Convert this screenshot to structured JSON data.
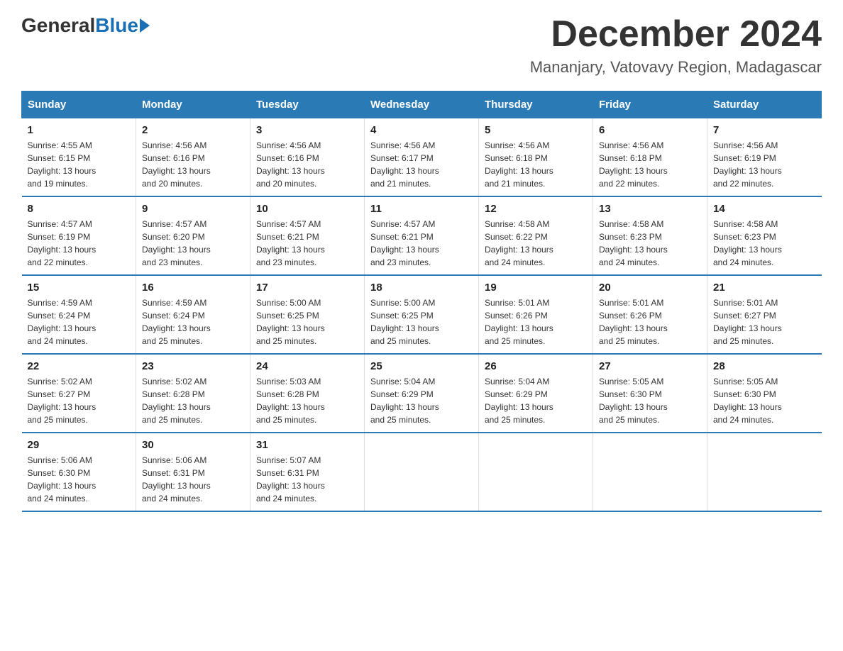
{
  "header": {
    "logo_general": "General",
    "logo_blue": "Blue",
    "month_title": "December 2024",
    "location": "Mananjary, Vatovavy Region, Madagascar"
  },
  "weekdays": [
    "Sunday",
    "Monday",
    "Tuesday",
    "Wednesday",
    "Thursday",
    "Friday",
    "Saturday"
  ],
  "weeks": [
    [
      {
        "day": "1",
        "sunrise": "4:55 AM",
        "sunset": "6:15 PM",
        "daylight": "13 hours and 19 minutes."
      },
      {
        "day": "2",
        "sunrise": "4:56 AM",
        "sunset": "6:16 PM",
        "daylight": "13 hours and 20 minutes."
      },
      {
        "day": "3",
        "sunrise": "4:56 AM",
        "sunset": "6:16 PM",
        "daylight": "13 hours and 20 minutes."
      },
      {
        "day": "4",
        "sunrise": "4:56 AM",
        "sunset": "6:17 PM",
        "daylight": "13 hours and 21 minutes."
      },
      {
        "day": "5",
        "sunrise": "4:56 AM",
        "sunset": "6:18 PM",
        "daylight": "13 hours and 21 minutes."
      },
      {
        "day": "6",
        "sunrise": "4:56 AM",
        "sunset": "6:18 PM",
        "daylight": "13 hours and 22 minutes."
      },
      {
        "day": "7",
        "sunrise": "4:56 AM",
        "sunset": "6:19 PM",
        "daylight": "13 hours and 22 minutes."
      }
    ],
    [
      {
        "day": "8",
        "sunrise": "4:57 AM",
        "sunset": "6:19 PM",
        "daylight": "13 hours and 22 minutes."
      },
      {
        "day": "9",
        "sunrise": "4:57 AM",
        "sunset": "6:20 PM",
        "daylight": "13 hours and 23 minutes."
      },
      {
        "day": "10",
        "sunrise": "4:57 AM",
        "sunset": "6:21 PM",
        "daylight": "13 hours and 23 minutes."
      },
      {
        "day": "11",
        "sunrise": "4:57 AM",
        "sunset": "6:21 PM",
        "daylight": "13 hours and 23 minutes."
      },
      {
        "day": "12",
        "sunrise": "4:58 AM",
        "sunset": "6:22 PM",
        "daylight": "13 hours and 24 minutes."
      },
      {
        "day": "13",
        "sunrise": "4:58 AM",
        "sunset": "6:23 PM",
        "daylight": "13 hours and 24 minutes."
      },
      {
        "day": "14",
        "sunrise": "4:58 AM",
        "sunset": "6:23 PM",
        "daylight": "13 hours and 24 minutes."
      }
    ],
    [
      {
        "day": "15",
        "sunrise": "4:59 AM",
        "sunset": "6:24 PM",
        "daylight": "13 hours and 24 minutes."
      },
      {
        "day": "16",
        "sunrise": "4:59 AM",
        "sunset": "6:24 PM",
        "daylight": "13 hours and 25 minutes."
      },
      {
        "day": "17",
        "sunrise": "5:00 AM",
        "sunset": "6:25 PM",
        "daylight": "13 hours and 25 minutes."
      },
      {
        "day": "18",
        "sunrise": "5:00 AM",
        "sunset": "6:25 PM",
        "daylight": "13 hours and 25 minutes."
      },
      {
        "day": "19",
        "sunrise": "5:01 AM",
        "sunset": "6:26 PM",
        "daylight": "13 hours and 25 minutes."
      },
      {
        "day": "20",
        "sunrise": "5:01 AM",
        "sunset": "6:26 PM",
        "daylight": "13 hours and 25 minutes."
      },
      {
        "day": "21",
        "sunrise": "5:01 AM",
        "sunset": "6:27 PM",
        "daylight": "13 hours and 25 minutes."
      }
    ],
    [
      {
        "day": "22",
        "sunrise": "5:02 AM",
        "sunset": "6:27 PM",
        "daylight": "13 hours and 25 minutes."
      },
      {
        "day": "23",
        "sunrise": "5:02 AM",
        "sunset": "6:28 PM",
        "daylight": "13 hours and 25 minutes."
      },
      {
        "day": "24",
        "sunrise": "5:03 AM",
        "sunset": "6:28 PM",
        "daylight": "13 hours and 25 minutes."
      },
      {
        "day": "25",
        "sunrise": "5:04 AM",
        "sunset": "6:29 PM",
        "daylight": "13 hours and 25 minutes."
      },
      {
        "day": "26",
        "sunrise": "5:04 AM",
        "sunset": "6:29 PM",
        "daylight": "13 hours and 25 minutes."
      },
      {
        "day": "27",
        "sunrise": "5:05 AM",
        "sunset": "6:30 PM",
        "daylight": "13 hours and 25 minutes."
      },
      {
        "day": "28",
        "sunrise": "5:05 AM",
        "sunset": "6:30 PM",
        "daylight": "13 hours and 24 minutes."
      }
    ],
    [
      {
        "day": "29",
        "sunrise": "5:06 AM",
        "sunset": "6:30 PM",
        "daylight": "13 hours and 24 minutes."
      },
      {
        "day": "30",
        "sunrise": "5:06 AM",
        "sunset": "6:31 PM",
        "daylight": "13 hours and 24 minutes."
      },
      {
        "day": "31",
        "sunrise": "5:07 AM",
        "sunset": "6:31 PM",
        "daylight": "13 hours and 24 minutes."
      },
      null,
      null,
      null,
      null
    ]
  ]
}
